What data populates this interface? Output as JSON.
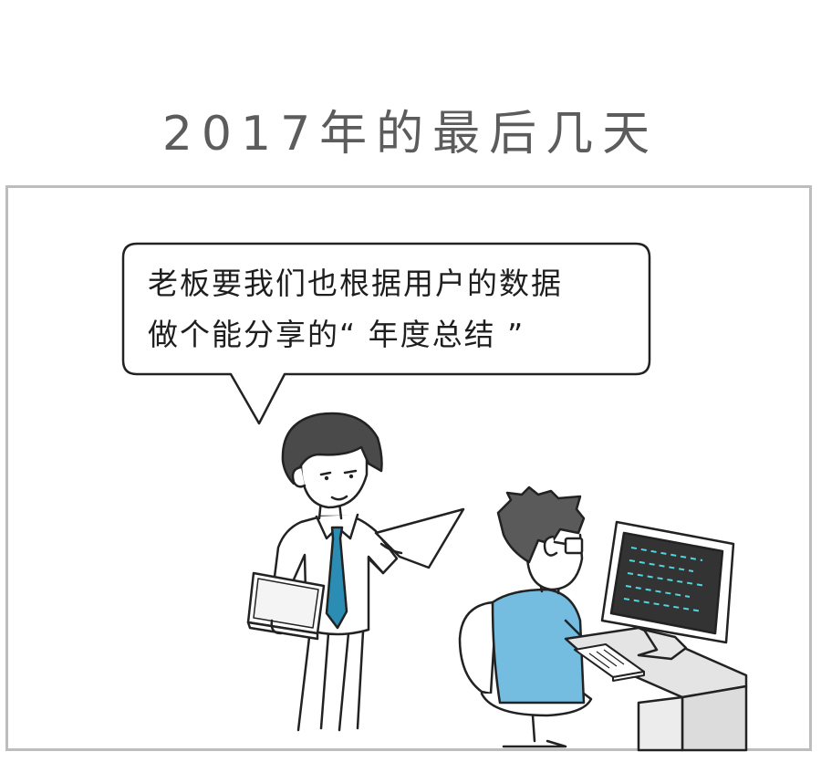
{
  "comic": {
    "title": "2017年的最后几天",
    "speech": {
      "line1": "老板要我们也根据用户的数据",
      "line2": "做个能分享的“ 年度总结 ”"
    }
  },
  "colors": {
    "title_gray": "#5c5c5c",
    "frame_gray": "#bdbdbd",
    "tie_blue": "#2b8db3",
    "vest_blue": "#74bce0",
    "hair_dark": "#4a4a4a",
    "screen_dark": "#333333",
    "code_cyan": "#4fd6e0"
  }
}
